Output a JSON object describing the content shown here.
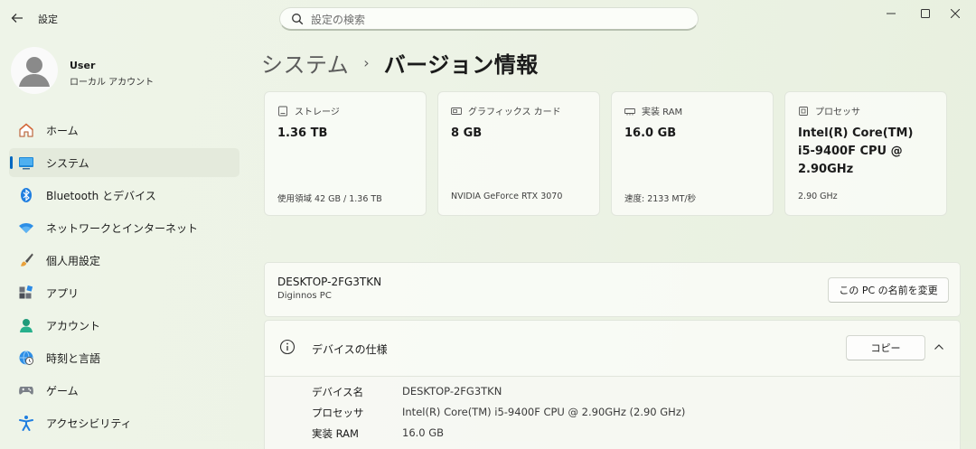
{
  "window": {
    "title": "設定",
    "back_icon": "arrow-left-icon",
    "controls": [
      "minimize-icon",
      "maximize-icon",
      "close-icon"
    ]
  },
  "search": {
    "placeholder": "設定の検索",
    "icon": "search-icon"
  },
  "profile": {
    "name": "User",
    "account_type": "ローカル アカウント"
  },
  "sidebar": {
    "active_index": 1,
    "items": [
      {
        "label": "ホーム",
        "icon": "home-icon"
      },
      {
        "label": "システム",
        "icon": "system-monitor-icon"
      },
      {
        "label": "Bluetooth とデバイス",
        "icon": "bluetooth-icon"
      },
      {
        "label": "ネットワークとインターネット",
        "icon": "wifi-icon"
      },
      {
        "label": "個人用設定",
        "icon": "paintbrush-icon"
      },
      {
        "label": "アプリ",
        "icon": "apps-icon"
      },
      {
        "label": "アカウント",
        "icon": "person-icon"
      },
      {
        "label": "時刻と言語",
        "icon": "globe-clock-icon"
      },
      {
        "label": "ゲーム",
        "icon": "gamepad-icon"
      },
      {
        "label": "アクセシビリティ",
        "icon": "accessibility-icon"
      }
    ]
  },
  "breadcrumb": {
    "parent": "システム",
    "separator": "›",
    "current": "バージョン情報"
  },
  "cards": [
    {
      "label": "ストレージ",
      "icon": "storage-icon",
      "value": "1.36 TB",
      "detail": "使用領域 42 GB / 1.36 TB"
    },
    {
      "label": "グラフィックス カード",
      "icon": "graphics-card-icon",
      "value": "8 GB",
      "detail": "NVIDIA GeForce RTX 3070"
    },
    {
      "label": "実装 RAM",
      "icon": "ram-icon",
      "value": "16.0 GB",
      "detail": "速度: 2133 MT/秒"
    },
    {
      "label": "プロセッサ",
      "icon": "processor-icon",
      "value": "Intel(R) Core(TM) i5-9400F CPU @ 2.90GHz",
      "detail": "2.90 GHz"
    }
  ],
  "device": {
    "name": "DESKTOP-2FG3TKN",
    "model": "Diginnos PC",
    "rename_button": "この PC の名前を変更"
  },
  "specs": {
    "title": "デバイスの仕様",
    "icon": "info-icon",
    "copy_button": "コピー",
    "collapse_icon": "chevron-up-icon",
    "rows": [
      {
        "key": "デバイス名",
        "value": "DESKTOP-2FG3TKN"
      },
      {
        "key": "プロセッサ",
        "value": "Intel(R) Core(TM) i5-9400F CPU @ 2.90GHz (2.90 GHz)"
      },
      {
        "key": "実装 RAM",
        "value": "16.0 GB"
      }
    ]
  }
}
